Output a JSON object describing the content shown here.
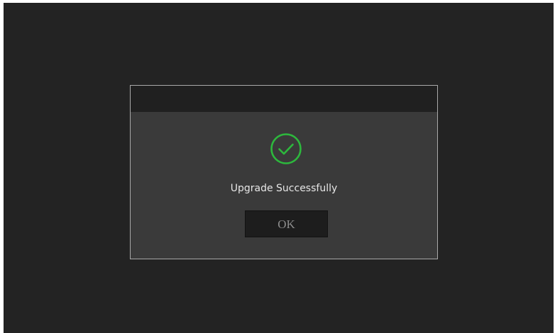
{
  "dialog": {
    "message": "Upgrade Successfully",
    "ok_label": "OK",
    "icon": "check-circle-icon",
    "icon_color": "#2db83d"
  },
  "colors": {
    "screen_background": "#232323",
    "dialog_background": "#3a3a3a",
    "titlebar_background": "#202020",
    "button_background": "#1d1d1d"
  }
}
